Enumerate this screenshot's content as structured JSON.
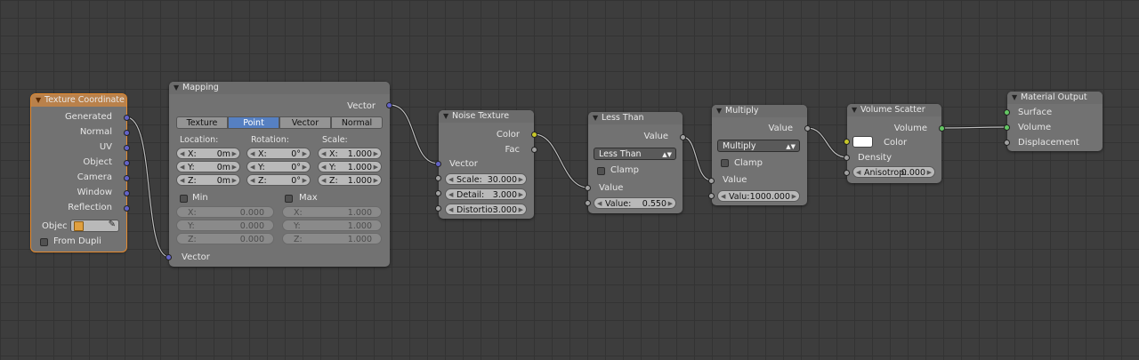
{
  "colors": {
    "vector_socket": "#6363c7",
    "color_socket": "#c7c729",
    "value_socket": "#a1a1a1",
    "shader_socket": "#63c763",
    "selected_outline": "#e58a2d"
  },
  "texture_coordinate": {
    "title": "Texture Coordinate",
    "outputs": [
      "Generated",
      "Normal",
      "UV",
      "Object",
      "Camera",
      "Window",
      "Reflection"
    ],
    "object_label": "Objec",
    "object_icon": "cube-icon",
    "eyedropper_icon": "eyedropper-icon",
    "from_dupli_label": "From Dupli"
  },
  "mapping": {
    "title": "Mapping",
    "output": "Vector",
    "tabs": [
      "Texture",
      "Point",
      "Vector",
      "Normal"
    ],
    "active_tab": "Point",
    "location_label": "Location:",
    "rotation_label": "Rotation:",
    "scale_label": "Scale:",
    "location": [
      {
        "axis": "X:",
        "value": "0m"
      },
      {
        "axis": "Y:",
        "value": "0m"
      },
      {
        "axis": "Z:",
        "value": "0m"
      }
    ],
    "rotation": [
      {
        "axis": "X:",
        "value": "0°"
      },
      {
        "axis": "Y:",
        "value": "0°"
      },
      {
        "axis": "Z:",
        "value": "0°"
      }
    ],
    "scale": [
      {
        "axis": "X:",
        "value": "1.000"
      },
      {
        "axis": "Y:",
        "value": "1.000"
      },
      {
        "axis": "Z:",
        "value": "1.000"
      }
    ],
    "min_label": "Min",
    "max_label": "Max",
    "min": [
      {
        "axis": "X:",
        "value": "0.000"
      },
      {
        "axis": "Y:",
        "value": "0.000"
      },
      {
        "axis": "Z:",
        "value": "0.000"
      }
    ],
    "max": [
      {
        "axis": "X:",
        "value": "1.000"
      },
      {
        "axis": "Y:",
        "value": "1.000"
      },
      {
        "axis": "Z:",
        "value": "1.000"
      }
    ],
    "input": "Vector"
  },
  "noise_texture": {
    "title": "Noise Texture",
    "output_color": "Color",
    "output_fac": "Fac",
    "input_vector": "Vector",
    "scale": {
      "label": "Scale:",
      "value": "30.000"
    },
    "detail": {
      "label": "Detail:",
      "value": "3.000"
    },
    "distortion": {
      "label": "Distortio:",
      "value": "3.000"
    }
  },
  "less_than": {
    "title": "Less Than",
    "output": "Value",
    "operation": "Less Than",
    "clamp_label": "Clamp",
    "input_value": "Value",
    "value": {
      "label": "Value:",
      "value": "0.550"
    }
  },
  "multiply": {
    "title": "Multiply",
    "output": "Value",
    "operation": "Multiply",
    "clamp_label": "Clamp",
    "input_value": "Value",
    "value": {
      "label": "Valu:",
      "value": "1000.000"
    }
  },
  "volume_scatter": {
    "title": "Volume Scatter",
    "output": "Volume",
    "input_color": "Color",
    "input_density": "Density",
    "anisotropy": {
      "label": "Anisotrop:",
      "value": "0.000"
    }
  },
  "material_output": {
    "title": "Material Output",
    "inputs": [
      "Surface",
      "Volume",
      "Displacement"
    ]
  }
}
